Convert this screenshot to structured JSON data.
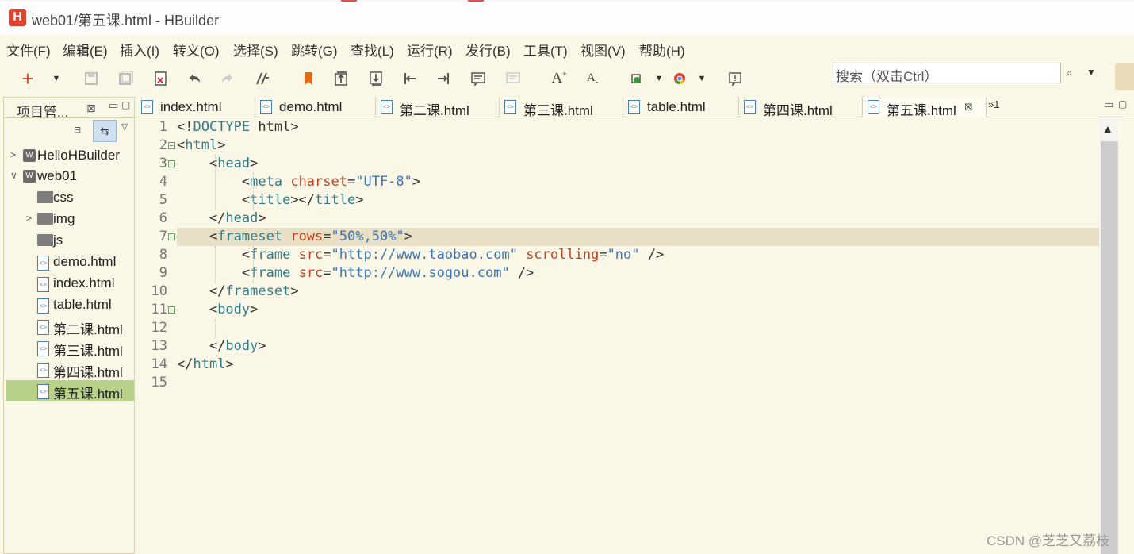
{
  "window": {
    "logo": "H",
    "title": "web01/第五课.html  -  HBuilder"
  },
  "menu": [
    "文件(F)",
    "编辑(E)",
    "插入(I)",
    "转义(O)",
    "选择(S)",
    "跳转(G)",
    "查找(L)",
    "运行(R)",
    "发行(B)",
    "工具(T)",
    "视图(V)",
    "帮助(H)"
  ],
  "toolbar": {
    "icons": [
      "new-icon",
      "new-dropdown-icon",
      "save-icon",
      "save-all-icon",
      "close-file-icon",
      "undo-icon",
      "redo-icon",
      "format-icon",
      "bookmark-icon",
      "goto-top-icon",
      "goto-bottom-icon",
      "goto-line-start-icon",
      "goto-line-end-icon",
      "comment-icon",
      "uncomment-icon",
      "font-increase-icon",
      "font-decrease-icon",
      "run-icon",
      "run-dropdown-icon",
      "chrome-icon",
      "browser-dropdown-icon",
      "preview-icon"
    ],
    "font_increase": "A+",
    "font_decrease": "A-",
    "search_placeholder": "搜索（双击Ctrl）",
    "search_icon": "⌕",
    "search_dropdown": "▼"
  },
  "project_panel": {
    "title": "项目管...",
    "close": "⊠",
    "tree": [
      {
        "label": "HelloHBuilder",
        "kind": "project",
        "twisty": ">",
        "indent": 0
      },
      {
        "label": "web01",
        "kind": "project",
        "twisty": "v",
        "indent": 0
      },
      {
        "label": "css",
        "kind": "folder",
        "twisty": "",
        "indent": 1
      },
      {
        "label": "img",
        "kind": "folder",
        "twisty": ">",
        "indent": 1
      },
      {
        "label": "js",
        "kind": "folder",
        "twisty": "",
        "indent": 1
      },
      {
        "label": "demo.html",
        "kind": "file",
        "twisty": "",
        "indent": 1
      },
      {
        "label": "index.html",
        "kind": "file",
        "twisty": "",
        "indent": 1
      },
      {
        "label": "table.html",
        "kind": "file",
        "twisty": "",
        "indent": 1
      },
      {
        "label": "第二课.html",
        "kind": "file",
        "twisty": "",
        "indent": 1
      },
      {
        "label": "第三课.html",
        "kind": "file",
        "twisty": "",
        "indent": 1
      },
      {
        "label": "第四课.html",
        "kind": "file",
        "twisty": "",
        "indent": 1
      },
      {
        "label": "第五课.html",
        "kind": "file",
        "twisty": "",
        "indent": 1,
        "selected": true
      }
    ]
  },
  "tabs": [
    {
      "label": "index.html"
    },
    {
      "label": "demo.html"
    },
    {
      "label": "第二课.html"
    },
    {
      "label": "第三课.html"
    },
    {
      "label": "table.html"
    },
    {
      "label": "第四课.html"
    },
    {
      "label": "第五课.html",
      "active": true
    }
  ],
  "tab_close": "⊠",
  "tab_overflow": "»1",
  "editor": {
    "current_line": 7,
    "lines": [
      [
        [
          "t-plain",
          "<!"
        ],
        [
          "t-tag",
          "DOCTYPE"
        ],
        [
          "t-plain",
          " html>"
        ]
      ],
      [
        [
          "t-plain",
          "<"
        ],
        [
          "t-tag",
          "html"
        ],
        [
          "t-plain",
          ">"
        ]
      ],
      [
        [
          "t-plain",
          "    <"
        ],
        [
          "t-tag",
          "head"
        ],
        [
          "t-plain",
          ">"
        ]
      ],
      [
        [
          "t-plain",
          "        <"
        ],
        [
          "t-tag",
          "meta"
        ],
        [
          "t-plain",
          " "
        ],
        [
          "t-attr",
          "charset"
        ],
        [
          "t-plain",
          "="
        ],
        [
          "t-val",
          "\"UTF-8\""
        ],
        [
          "t-plain",
          ">"
        ]
      ],
      [
        [
          "t-plain",
          "        <"
        ],
        [
          "t-tag",
          "title"
        ],
        [
          "t-plain",
          "></"
        ],
        [
          "t-tag",
          "title"
        ],
        [
          "t-plain",
          ">"
        ]
      ],
      [
        [
          "t-plain",
          "    </"
        ],
        [
          "t-tag",
          "head"
        ],
        [
          "t-plain",
          ">"
        ]
      ],
      [
        [
          "t-plain",
          "    <"
        ],
        [
          "t-tag",
          "frameset"
        ],
        [
          "t-plain",
          " "
        ],
        [
          "t-attr",
          "rows"
        ],
        [
          "t-plain",
          "="
        ],
        [
          "t-val",
          "\"50%,50%\""
        ],
        [
          "t-plain",
          ">"
        ]
      ],
      [
        [
          "t-plain",
          "        <"
        ],
        [
          "t-tag",
          "frame"
        ],
        [
          "t-plain",
          " "
        ],
        [
          "t-attr",
          "src"
        ],
        [
          "t-plain",
          "="
        ],
        [
          "t-val",
          "\"http://www.taobao.com\""
        ],
        [
          "t-plain",
          " "
        ],
        [
          "t-attr",
          "scrolling"
        ],
        [
          "t-plain",
          "="
        ],
        [
          "t-val",
          "\"no\""
        ],
        [
          "t-plain",
          " />"
        ]
      ],
      [
        [
          "t-plain",
          "        <"
        ],
        [
          "t-tag",
          "frame"
        ],
        [
          "t-plain",
          " "
        ],
        [
          "t-attr",
          "src"
        ],
        [
          "t-plain",
          "="
        ],
        [
          "t-val",
          "\"http://www.sogou.com\""
        ],
        [
          "t-plain",
          " />"
        ]
      ],
      [
        [
          "t-plain",
          "    </"
        ],
        [
          "t-tag",
          "frameset"
        ],
        [
          "t-plain",
          ">"
        ]
      ],
      [
        [
          "t-plain",
          "    <"
        ],
        [
          "t-tag",
          "body"
        ],
        [
          "t-plain",
          ">"
        ]
      ],
      [],
      [
        [
          "t-plain",
          "    </"
        ],
        [
          "t-tag",
          "body"
        ],
        [
          "t-plain",
          ">"
        ]
      ],
      [
        [
          "t-plain",
          "</"
        ],
        [
          "t-tag",
          "html"
        ],
        [
          "t-plain",
          ">"
        ]
      ],
      []
    ],
    "fold_lines": [
      2,
      3,
      7,
      11
    ]
  },
  "watermark": "CSDN @芝芝又荔枝",
  "colors": {
    "background": "#fbf7e6",
    "current_line": "#e8dfc4",
    "tag": "#2e7d8c",
    "attr": "#c04020",
    "value": "#3b76b8",
    "selected_tree": "#b8d28a"
  }
}
